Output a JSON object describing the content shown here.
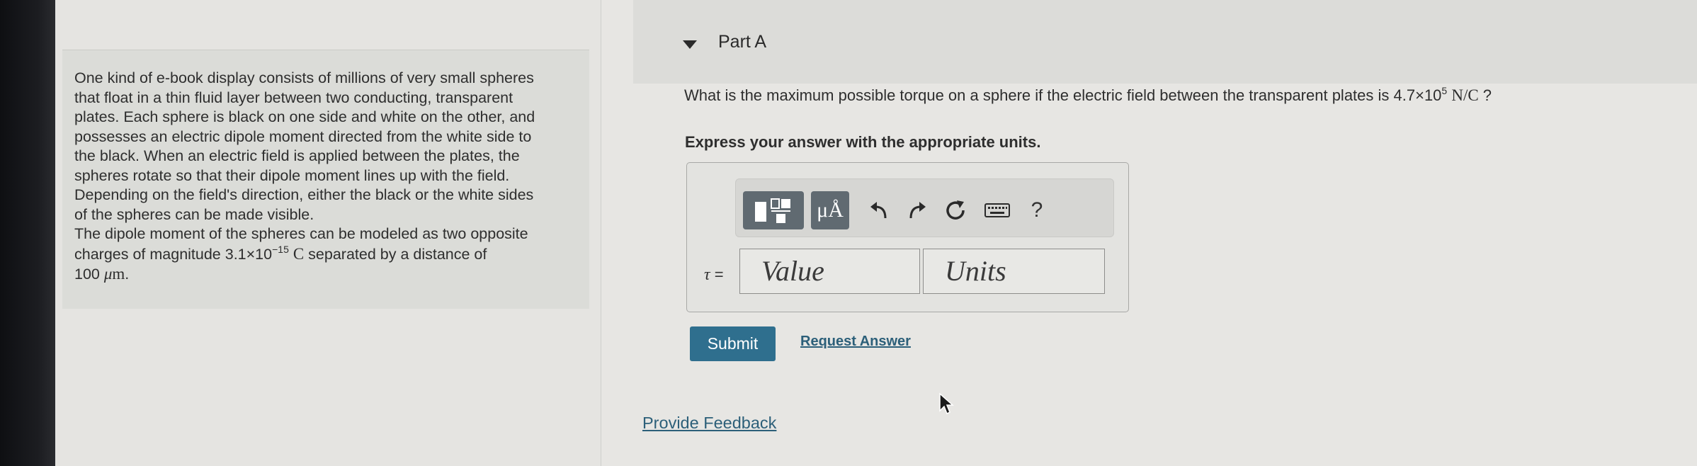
{
  "problem": {
    "line1": "One kind of e-book display consists of millions of very small spheres",
    "line2": "that float in a thin fluid layer between two conducting, transparent",
    "line3": "plates. Each sphere is black on one side and white on the other, and",
    "line4": "possesses an electric dipole moment directed from the white side to",
    "line5": "the black. When an electric field is applied between the plates, the",
    "line6": "spheres rotate so that their dipole moment lines up with the field.",
    "line7": "Depending on the field's direction, either the black or the white sides",
    "line8": "of the spheres can be made visible.",
    "line9": "The dipole moment of the spheres can be modeled as two opposite",
    "line10_pre": "charges of magnitude 3.1×10",
    "charge_exp": "−15",
    "charge_unit": "C",
    "line10_post": " separated by a distance of",
    "distance_value": "100 ",
    "distance_unit_mu": "μ",
    "distance_unit_m": "m",
    "distance_end": "."
  },
  "part": {
    "title": "Part A",
    "question_pre": "What is the maximum possible torque on a sphere if the electric field between the transparent plates is 4.7×10",
    "field_exp": "5",
    "field_unit": "N/C",
    "question_post": " ?",
    "instruction": "Express your answer with the appropriate units."
  },
  "toolbar": {
    "units_label": "μÅ",
    "help_label": "?",
    "icons": [
      "templates-icon",
      "units-icon",
      "undo-icon",
      "redo-icon",
      "reset-icon",
      "keyboard-icon",
      "help-icon"
    ]
  },
  "answer": {
    "label_symbol": "τ",
    "label_eq": " =",
    "value_placeholder": "Value",
    "units_placeholder": "Units"
  },
  "actions": {
    "submit": "Submit",
    "request_answer": "Request Answer",
    "provide_feedback": "Provide Feedback"
  },
  "colors": {
    "submit_bg": "#2f6f8e",
    "link": "#2c5f79",
    "toolbar_btn": "#606a71"
  }
}
